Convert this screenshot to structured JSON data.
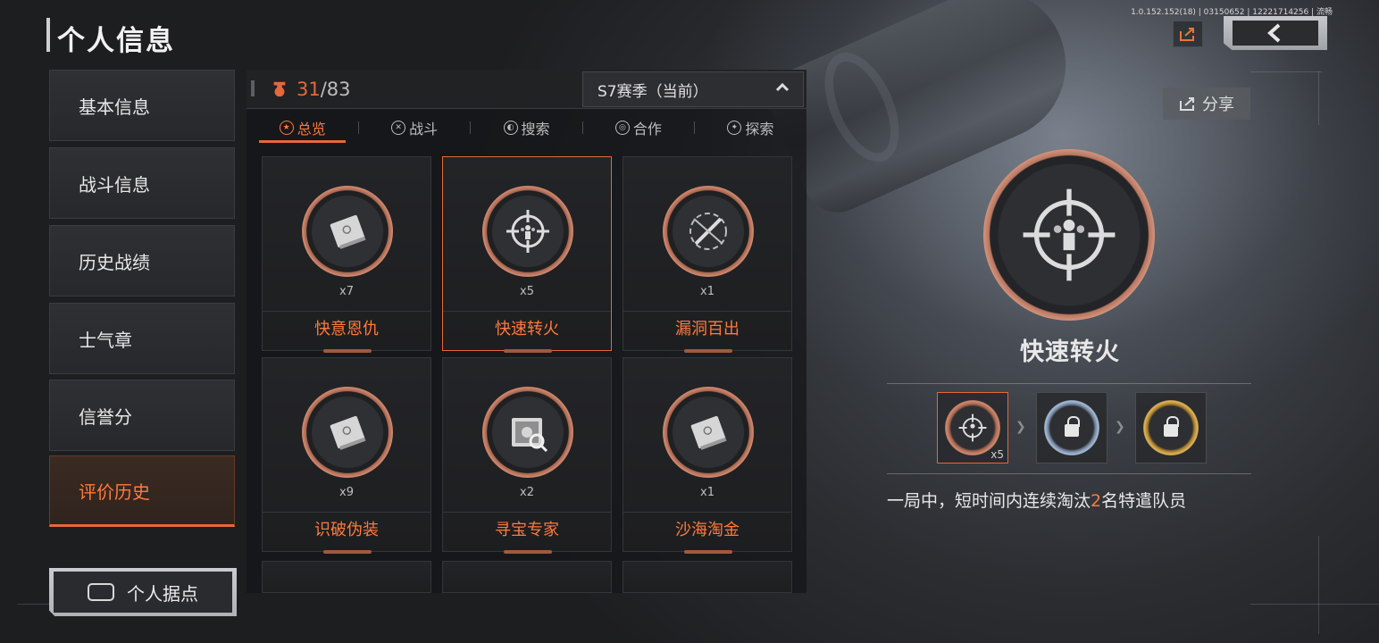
{
  "header": {
    "title": "个人信息",
    "build_info": "1.0.152.152(18) | 03150652 | 12221714256 | 流畅",
    "export_icon": "export-icon",
    "back_icon": "chevron-left-icon"
  },
  "sidebar": {
    "items": [
      {
        "label": "基本信息"
      },
      {
        "label": "战斗信息"
      },
      {
        "label": "历史战绩"
      },
      {
        "label": "士气章"
      },
      {
        "label": "信誉分"
      },
      {
        "label": "评价历史",
        "active": true
      }
    ],
    "base_button": "个人据点"
  },
  "panel": {
    "count_current": "31",
    "count_total": "/83",
    "season": "S7赛季（当前）",
    "tabs": [
      {
        "label": "总览",
        "active": true
      },
      {
        "label": "战斗"
      },
      {
        "label": "搜索"
      },
      {
        "label": "合作"
      },
      {
        "label": "探索"
      }
    ],
    "cards": [
      {
        "name": "快意恩仇",
        "count": "x7",
        "icon": "card-icon"
      },
      {
        "name": "快速转火",
        "count": "x5",
        "icon": "crosshair-icon",
        "selected": true
      },
      {
        "name": "漏洞百出",
        "count": "x1",
        "icon": "rifle-icon"
      },
      {
        "name": "识破伪装",
        "count": "x9",
        "icon": "card-icon"
      },
      {
        "name": "寻宝专家",
        "count": "x2",
        "icon": "safe-icon"
      },
      {
        "name": "沙海淘金",
        "count": "x1",
        "icon": "card-icon"
      }
    ]
  },
  "detail": {
    "share_label": "分享",
    "name": "快速转火",
    "tier_count": "x5",
    "desc_prefix": "一局中，短时间内连续淘汰",
    "desc_highlight": "2",
    "desc_suffix": "名特遣队员"
  },
  "colors": {
    "accent": "#e5693a",
    "accent_text": "#ff7a3c",
    "tier_silver": "#8fa4c0",
    "tier_gold": "#d6a64a"
  }
}
